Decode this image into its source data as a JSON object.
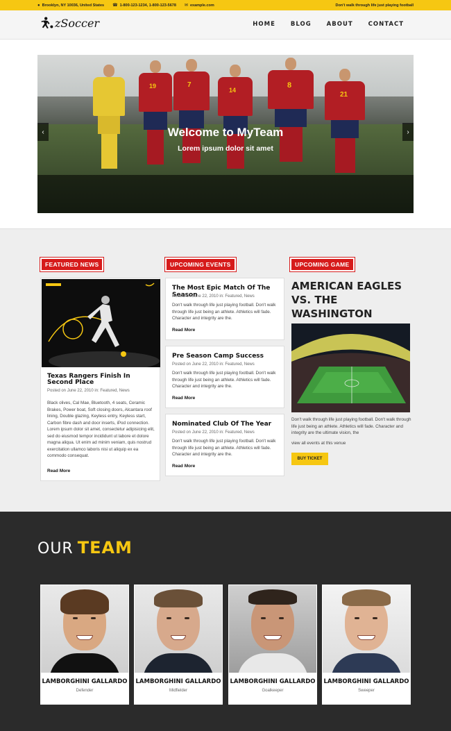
{
  "topbar": {
    "address": "Brooklyn, NY 10036, United States",
    "phone": "1-800-123-1234, 1-800-123-5678",
    "email": "example.com",
    "tagline": "Don't walk through life just playing football"
  },
  "header": {
    "logo_text": "zSoccer",
    "nav": [
      "HOME",
      "BLOG",
      "ABOUT",
      "CONTACT"
    ]
  },
  "hero": {
    "title": "Welcome to MyTeam",
    "subtitle": "Lorem ipsum dolor sit amet",
    "jersey_numbers": [
      "19",
      "7",
      "14",
      "8",
      "21"
    ]
  },
  "featured": {
    "label": "FEATURED NEWS",
    "title": "Texas Rangers Finish In Second Place",
    "meta": "Posted on June 22, 2010 in: Featured, News",
    "body": "Black olives, Cal Mae, Bluetooth, 4 seats, Ceramic Brakes, Power boat, Soft closing doors, Alcantara roof lining, Double glazing, Keyless entry, Keyless start, Carbon fibre dash and door inserts, iPod connection. Lorem ipsum dolor sit amet, consectetur adipisicing elit, sed do eiusmod tempor incididunt ut labore et dolore magna aliqua. Ut enim ad minim veniam, quis nostrud exercitation ullamco laboris nisi ut aliquip ex ea commodo consequat.",
    "read_more": "Read More"
  },
  "events": {
    "label": "UPCOMING EVENTS",
    "items": [
      {
        "title": "The Most Epic Match Of The Season",
        "meta": "Posted on June 22, 2010 in: Featured, News",
        "body": "Don't walk through life just playing football. Don't walk through life just being an athlete. Athletics will fade. Character and integrity are the.",
        "read_more": "Read More"
      },
      {
        "title": "Pre Season Camp Success",
        "meta": "Posted on June 22, 2010 in: Featured, News",
        "body": "Don't walk through life just playing football. Don't walk through life just being an athlete. Athletics will fade. Character and integrity are the.",
        "read_more": "Read More"
      },
      {
        "title": "Nominated Club Of The Year",
        "meta": "Posted on June 22, 2010 in: Featured, News",
        "body": "Don't walk through life just playing football. Don't walk through life just being an athlete. Athletics will fade. Character and integrity are the.",
        "read_more": "Read More"
      }
    ]
  },
  "game": {
    "label": "UPCOMING GAME",
    "title": "AMERICAN EAGLES VS. THE WASHINGTON REDSKINS",
    "body": "Don't walk through life just playing football. Don't walk through life just being an athlete. Athletics will fade. Character and integrity are the ultimate vision, the",
    "link": "view all events at this venue",
    "button": "BUY TICKET"
  },
  "team": {
    "heading_1": "OUR",
    "heading_2": "TEAM",
    "members": [
      {
        "name": "LAMBORGHINI GALLARDO",
        "role": "Defender"
      },
      {
        "name": "LAMBORGHINI GALLARDO",
        "role": "Midfielder"
      },
      {
        "name": "LAMBORGHINI GALLARDO",
        "role": "Goalkeeper"
      },
      {
        "name": "LAMBORGHINI GALLARDO",
        "role": "Sweeper"
      }
    ]
  },
  "colors": {
    "accent_yellow": "#f6c712",
    "accent_red": "#d61b1b",
    "dark_bg": "#2b2b2b"
  }
}
